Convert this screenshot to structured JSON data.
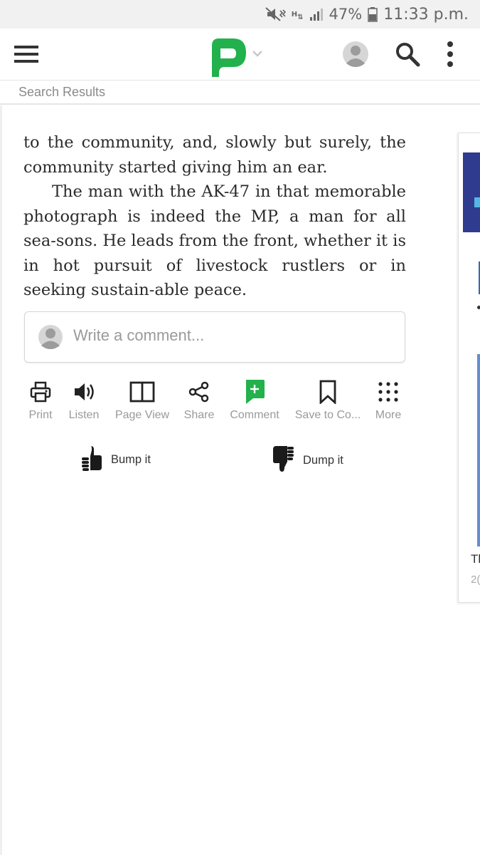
{
  "status_bar": {
    "network": "H",
    "battery": "47%",
    "time": "11:33 p.m."
  },
  "app_bar": {
    "menu_icon": "hamburger-icon",
    "logo_icon": "p-logo-icon",
    "accent_color": "#22b14c"
  },
  "breadcrumb": {
    "label": "Search Results"
  },
  "article": {
    "paragraphs": [
      "to the community, and, slowly but surely, the community started giving him an ear.",
      "The man with the AK-47 in that memorable photograph is indeed the MP, a man for all sea-sons. He leads from the front, whether it is in hot pursuit of livestock rustlers or in seeking sustain-able peace."
    ]
  },
  "comment": {
    "placeholder": "Write a comment..."
  },
  "toolbar": [
    {
      "label": "Print",
      "icon": "printer-icon"
    },
    {
      "label": "Listen",
      "icon": "speaker-icon"
    },
    {
      "label": "Page View",
      "icon": "book-icon"
    },
    {
      "label": "Share",
      "icon": "share-icon"
    },
    {
      "label": "Comment",
      "icon": "comment-plus-icon"
    },
    {
      "label": "Save to Co...",
      "icon": "bookmark-icon"
    },
    {
      "label": "More",
      "icon": "grid-dots-icon"
    }
  ],
  "votes": {
    "bump": "Bump it",
    "dump": "Dump it"
  },
  "side_card": {
    "title_fragment": "Tl",
    "date_fragment": "2("
  }
}
